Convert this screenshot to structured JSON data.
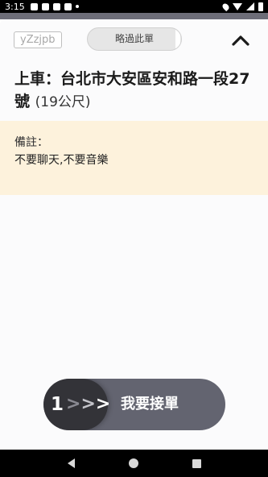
{
  "status_bar": {
    "time": "3:15"
  },
  "order": {
    "code": "yZzjpb",
    "skip_label": "略過此單",
    "pickup_prefix": "上車：",
    "pickup_address": "台北市大安區安和路一段27號",
    "distance": "(19公尺)"
  },
  "notes": {
    "title": "備註：",
    "text": "不要聊天,不要音樂"
  },
  "accept_slider": {
    "step": "1",
    "chevrons": [
      ">",
      ">",
      ">"
    ],
    "label": "我要接單"
  },
  "icons": {
    "collapse": "chevron-up-icon",
    "nav_back": "back-triangle-icon",
    "nav_home": "home-circle-icon",
    "nav_recents": "recents-square-icon"
  },
  "colors": {
    "notes_background": "#fdf2dc",
    "slider_track": "#636470",
    "slider_knob": "#333338"
  }
}
